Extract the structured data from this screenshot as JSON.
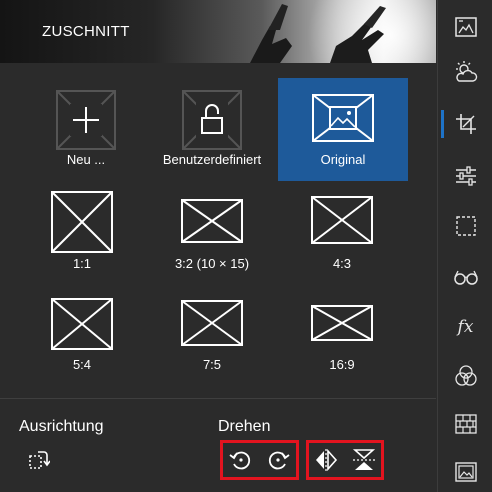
{
  "header": {
    "title": "ZUSCHNITT"
  },
  "crop_presets": [
    {
      "label": "Neu ...",
      "icon": "add-icon"
    },
    {
      "label": "Benutzerdefiniert",
      "icon": "unlock-icon"
    },
    {
      "label": "Original",
      "icon": "image-icon",
      "selected": true
    },
    {
      "label": "1:1",
      "icon": "aspect-frame-icon"
    },
    {
      "label": "3:2 (10 × 15)",
      "icon": "aspect-frame-icon"
    },
    {
      "label": "4:3",
      "icon": "aspect-frame-icon"
    },
    {
      "label": "5:4",
      "icon": "aspect-frame-icon"
    },
    {
      "label": "7:5",
      "icon": "aspect-frame-icon"
    },
    {
      "label": "16:9",
      "icon": "aspect-frame-icon"
    }
  ],
  "orientation": {
    "label": "Ausrichtung",
    "icon": "orientation-icon"
  },
  "rotate": {
    "label": "Drehen",
    "buttons": [
      "rotate-left-icon",
      "rotate-right-icon",
      "flip-horizontal-icon",
      "flip-vertical-icon"
    ]
  },
  "sidebar": {
    "items": [
      "image-enhance-icon",
      "weather-icon",
      "crop-icon",
      "adjust-sliders-icon",
      "selection-icon",
      "glasses-icon",
      "fx-icon",
      "color-circles-icon",
      "texture-icon",
      "gallery-icon"
    ],
    "active": "crop-icon",
    "fx_label": "fx"
  },
  "colors": {
    "accent": "#1e5a9a",
    "highlight": "#e3141f",
    "active_indicator": "#1e73c8"
  }
}
